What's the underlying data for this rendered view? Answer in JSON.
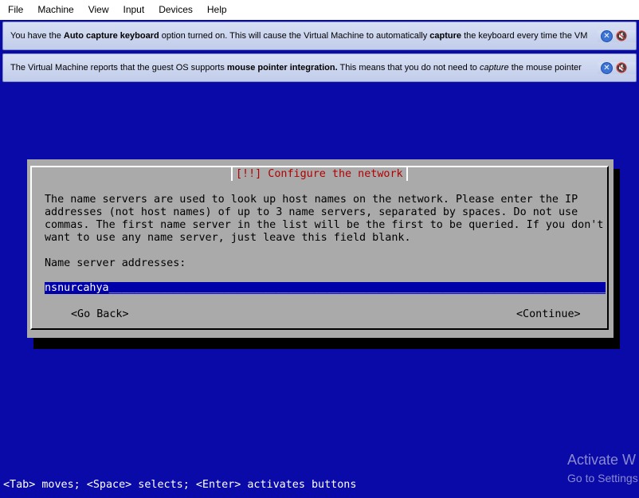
{
  "menubar": {
    "items": [
      "File",
      "Machine",
      "View",
      "Input",
      "Devices",
      "Help"
    ]
  },
  "notices": [
    {
      "parts": [
        {
          "t": "You have the ",
          "s": ""
        },
        {
          "t": "Auto capture keyboard",
          "s": "b"
        },
        {
          "t": " option turned on. This will cause the Virtual Machine to automatically ",
          "s": ""
        },
        {
          "t": "capture",
          "s": "b"
        },
        {
          "t": " the keyboard every time the VM",
          "s": ""
        }
      ],
      "icons": [
        "close-icon",
        "mute-notification-icon"
      ]
    },
    {
      "parts": [
        {
          "t": "The Virtual Machine reports that the guest OS supports ",
          "s": ""
        },
        {
          "t": "mouse pointer integration.",
          "s": "b"
        },
        {
          "t": " This means that you do not need to ",
          "s": ""
        },
        {
          "t": "capture",
          "s": "i"
        },
        {
          "t": " the mouse pointer",
          "s": ""
        }
      ],
      "icons": [
        "close-icon",
        "mute-notification-icon"
      ]
    }
  ],
  "dialog": {
    "title": "[!!] Configure the network",
    "body": "The name servers are used to look up host names on the network. Please enter the IP\naddresses (not host names) of up to 3 name servers, separated by spaces. Do not use\ncommas. The first name server in the list will be the first to be queried. If you don't\nwant to use any name server, just leave this field blank.",
    "field_label": "Name server addresses:",
    "field_value": "nsnurcahya",
    "field_fill": "________________________________________________________________________________________________",
    "back_button": "<Go Back>",
    "continue_button": "<Continue>"
  },
  "help_line": "<Tab> moves; <Space> selects; <Enter> activates buttons",
  "watermark": {
    "line1": "Activate W",
    "line2": "Go to Settings"
  },
  "colors": {
    "background": "#0a0aa8",
    "dialog": "#aaaaaa",
    "title": "#b30000",
    "field": "#0000aa"
  }
}
